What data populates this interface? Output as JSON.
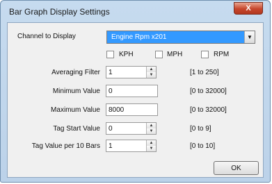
{
  "window": {
    "title": "Bar Graph Display Settings",
    "close_label": "X"
  },
  "channel": {
    "label": "Channel to Display",
    "selected": "Engine Rpm x201",
    "arrow": "▼"
  },
  "units": [
    {
      "label": "KPH",
      "checked": false
    },
    {
      "label": "MPH",
      "checked": false
    },
    {
      "label": "RPM",
      "checked": false
    }
  ],
  "fields": {
    "averaging_filter": {
      "label": "Averaging Filter",
      "value": "1",
      "range": "[1 to 250]"
    },
    "minimum_value": {
      "label": "Minimum Value",
      "value": "0",
      "range": "[0 to 32000]"
    },
    "maximum_value": {
      "label": "Maximum Value",
      "value": "8000",
      "range": "[0 to 32000]"
    },
    "tag_start_value": {
      "label": "Tag Start Value",
      "value": "0",
      "range": "[0 to 9]"
    },
    "tag_value_per_10_bars": {
      "label": "Tag Value per 10 Bars",
      "value": "1",
      "range": "[0 to 10]"
    }
  },
  "spin_arrows": {
    "up": "▲",
    "down": "▼"
  },
  "ok_label": "OK",
  "colors": {
    "selection": "#3399ff",
    "close": "#c6462c"
  }
}
